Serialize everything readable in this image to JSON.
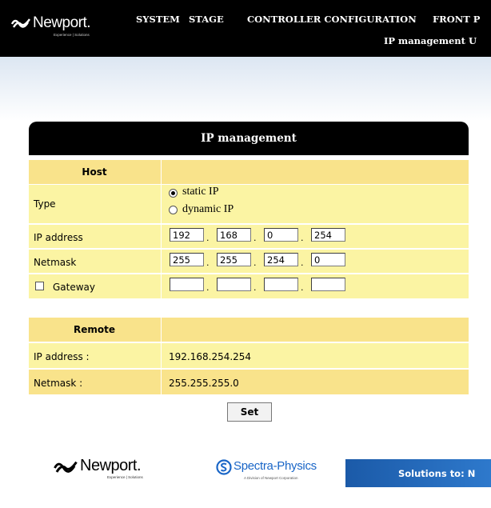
{
  "header": {
    "logo_text": "Newport.",
    "logo_tagline": "Experience | Solutions",
    "menu": [
      "SYSTEM",
      "STAGE",
      "CONTROLLER CONFIGURATION",
      "FRONT P"
    ],
    "submenu": "IP management  U"
  },
  "panel": {
    "title": "IP management",
    "host": {
      "header": "Host",
      "type_label": "Type",
      "type_options": [
        "static IP",
        "dynamic IP"
      ],
      "type_selected": "static IP",
      "ip_label": "IP address",
      "ip": [
        "192",
        "168",
        "0",
        "254"
      ],
      "netmask_label": "Netmask",
      "netmask": [
        "255",
        "255",
        "254",
        "0"
      ],
      "gateway_label": "Gateway",
      "gateway_checked": false,
      "gateway": [
        "",
        "",
        "",
        ""
      ],
      "separator": "."
    },
    "remote": {
      "header": "Remote",
      "ip_label": "IP address :",
      "ip_value": "192.168.254.254",
      "netmask_label": "Netmask :",
      "netmask_value": "255.255.255.0"
    },
    "set_button": "Set"
  },
  "footer": {
    "newport_text": "Newport.",
    "newport_tagline": "Experience | Solutions",
    "spectra_text": "Spectra-Physics",
    "spectra_tagline": "A Division of Newport Corporation",
    "solutions_text": "Solutions to: N"
  },
  "colors": {
    "header_bg": "#000000",
    "row_light": "#fbf4a3",
    "row_dark": "#f9e38b",
    "accent_blue": "#1a66c7"
  }
}
